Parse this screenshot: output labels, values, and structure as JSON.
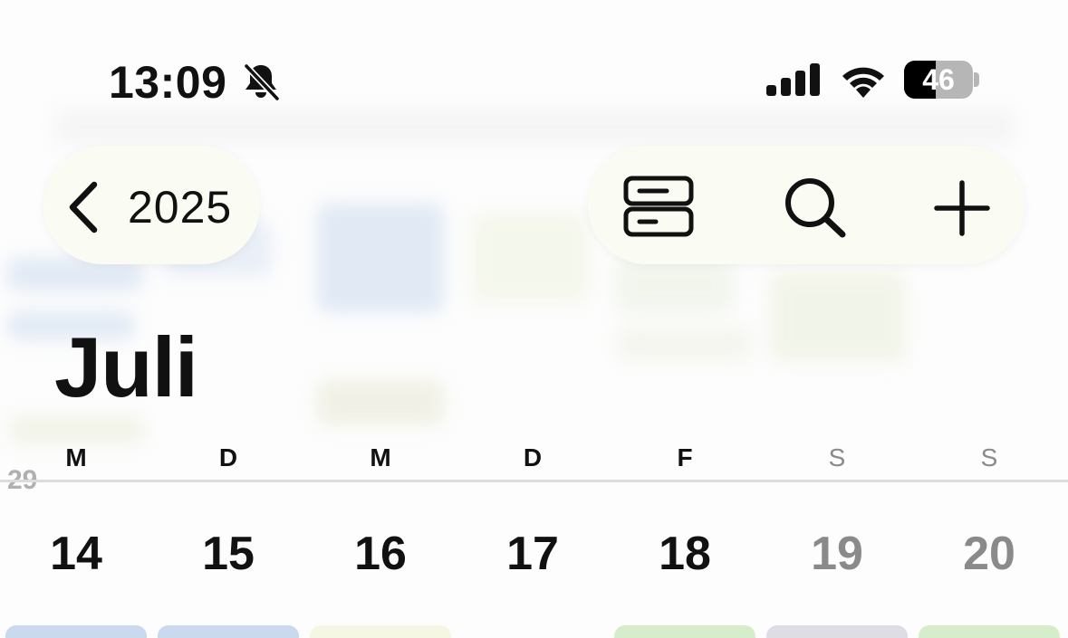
{
  "status_bar": {
    "time": "13:09",
    "battery_level": "46",
    "battery_fraction": 0.46,
    "icons": [
      "bell-slash-icon",
      "cellular-signal-icon",
      "wifi-icon",
      "battery-icon"
    ]
  },
  "toolbar": {
    "back_label": "2025",
    "icons": [
      "chevron-left-icon",
      "calendar-views-icon",
      "search-icon",
      "plus-icon"
    ]
  },
  "month": {
    "title": "Juli"
  },
  "week": {
    "weekdays": [
      "M",
      "D",
      "M",
      "D",
      "F",
      "S",
      "S"
    ],
    "days": [
      "14",
      "15",
      "16",
      "17",
      "18",
      "19",
      "20"
    ],
    "previous_row_partial_day": "29"
  },
  "colors": {
    "chip_blue": "#c9d9ee",
    "chip_cream": "#f6f7e2",
    "chip_green": "#d6edcc",
    "chip_gray": "#dedde6",
    "weekend_gray": "#8a8a8a"
  }
}
